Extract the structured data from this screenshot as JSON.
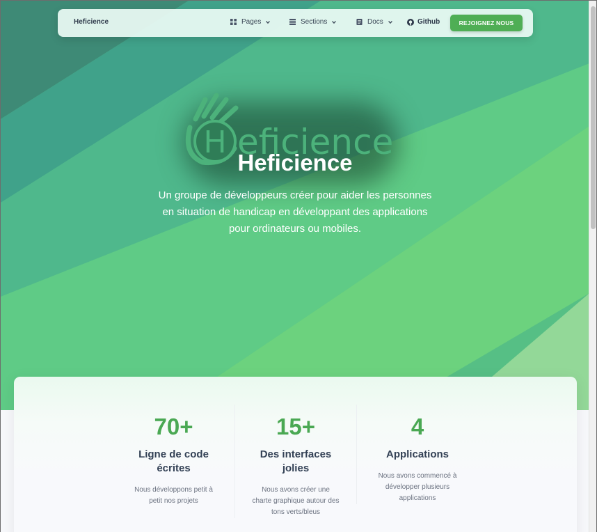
{
  "colors": {
    "accent": "#4fae55",
    "stat_value": "#4aa853",
    "hero_dark": "#3f8f7f",
    "hero_light": "#6fd47e"
  },
  "navbar": {
    "brand": "Heficience",
    "items": [
      {
        "label": "Pages",
        "icon": "grid-icon"
      },
      {
        "label": "Sections",
        "icon": "stack-icon"
      },
      {
        "label": "Docs",
        "icon": "document-icon"
      }
    ],
    "github": {
      "label": "Github",
      "icon": "github-icon"
    },
    "cta": "REJOIGNEZ NOUS"
  },
  "hero": {
    "logo_text": "eficience",
    "logo_letter": "H",
    "title": "Heficience",
    "description": "Un groupe de développeurs créer pour aider les personnes en situation de handicap en développant des applications pour ordinateurs ou mobiles."
  },
  "stats": [
    {
      "value": "70+",
      "title": "Ligne de code écrites",
      "description": "Nous développons petit à petit nos projets"
    },
    {
      "value": "15+",
      "title": "Des interfaces jolies",
      "description": "Nous avons créer une charte graphique autour des tons verts/bleus"
    },
    {
      "value": "4",
      "title": "Applications",
      "description": "Nous avons commencé à développer plusieurs applications"
    }
  ]
}
